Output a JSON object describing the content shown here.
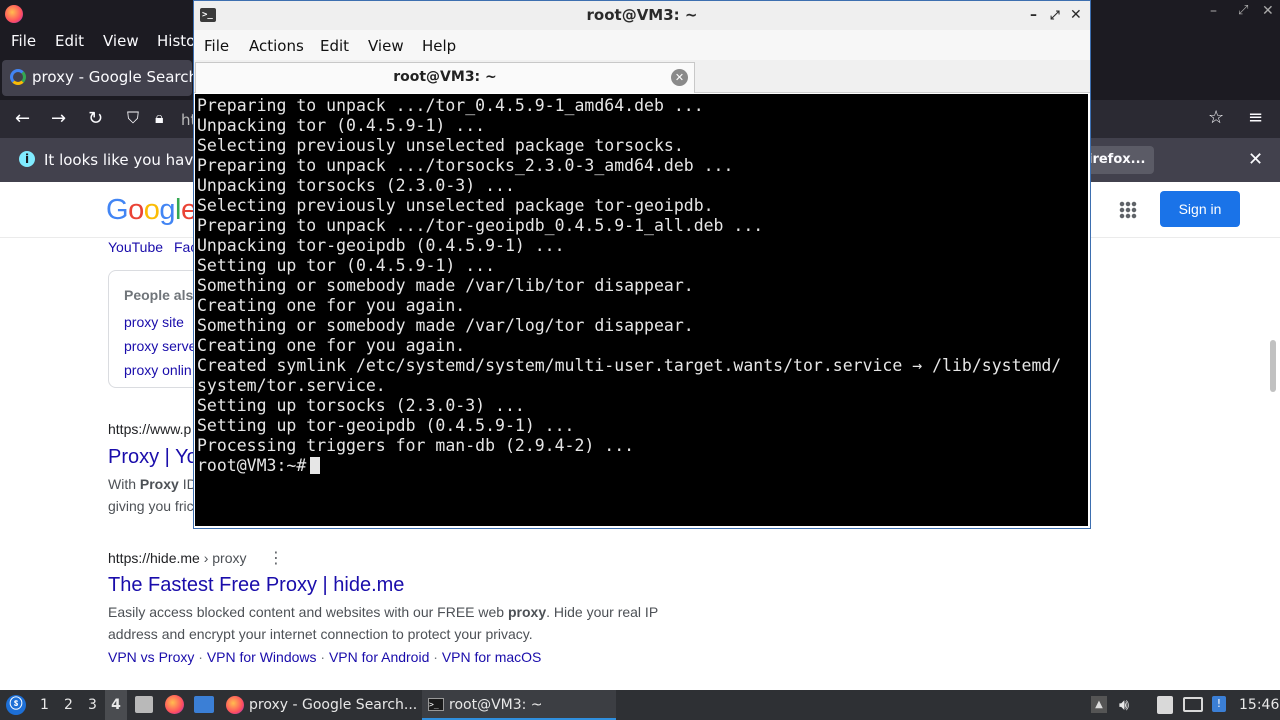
{
  "firefox": {
    "menu": [
      "File",
      "Edit",
      "View",
      "Histo"
    ],
    "tab_title": "proxy - Google Search",
    "url_partial": "ht",
    "notification_text": "It looks like you haven",
    "notification_button_partial": "irefox..."
  },
  "google": {
    "logo_partial": "Google",
    "signin_label": "Sign in",
    "chips": [
      "YouTube",
      "Fac"
    ],
    "people_also_title": "People als",
    "people_also_items": [
      "proxy site",
      "proxy serve",
      "proxy onlin"
    ],
    "result1": {
      "url": "https://www.p",
      "title": "Proxy | Yo",
      "snippet_line1_pre": "With ",
      "snippet_line1_bold": "Proxy",
      "snippet_line1_post": " ID",
      "snippet_line2": "giving you fric"
    },
    "result2": {
      "url_domain": "https://hide.me",
      "url_path": " › proxy",
      "title": "The Fastest Free Proxy | hide.me",
      "snippet_line1_pre": "Easily access blocked content and websites with our FREE web ",
      "snippet_line1_bold": "proxy",
      "snippet_line1_post": ". Hide your real IP",
      "snippet_line2": "address and encrypt your internet connection to protect your privacy.",
      "sitelinks": [
        "VPN vs Proxy",
        "VPN for Windows",
        "VPN for Android",
        "VPN for macOS"
      ]
    }
  },
  "terminal": {
    "window_title": "root@VM3: ~",
    "menu": [
      "File",
      "Actions",
      "Edit",
      "View",
      "Help"
    ],
    "tab_title": "root@VM3: ~",
    "lines": [
      "Preparing to unpack .../tor_0.4.5.9-1_amd64.deb ...",
      "Unpacking tor (0.4.5.9-1) ...",
      "Selecting previously unselected package torsocks.",
      "Preparing to unpack .../torsocks_2.3.0-3_amd64.deb ...",
      "Unpacking torsocks (2.3.0-3) ...",
      "Selecting previously unselected package tor-geoipdb.",
      "Preparing to unpack .../tor-geoipdb_0.4.5.9-1_all.deb ...",
      "Unpacking tor-geoipdb (0.4.5.9-1) ...",
      "Setting up tor (0.4.5.9-1) ...",
      "Something or somebody made /var/lib/tor disappear.",
      "Creating one for you again.",
      "Something or somebody made /var/log/tor disappear.",
      "Creating one for you again.",
      "Created symlink /etc/systemd/system/multi-user.target.wants/tor.service → /lib/systemd/",
      "system/tor.service.",
      "Setting up torsocks (2.3.0-3) ...",
      "Setting up tor-geoipdb (0.4.5.9-1) ...",
      "Processing triggers for man-db (2.9.4-2) ..."
    ],
    "prompt": "root@VM3:~#"
  },
  "taskbar": {
    "workspaces": [
      "1",
      "2",
      "3",
      "4"
    ],
    "active_workspace": "4",
    "firefox_task": "proxy - Google Search...",
    "terminal_task": "root@VM3: ~",
    "clock": "15:46"
  },
  "colors": {
    "firefox_dark": "#1c1b22",
    "google_blue": "#1a73e8",
    "link": "#1a0dab",
    "terminal_bg": "#000000",
    "terminal_fg": "#e6e6e6",
    "taskbar": "#2e3034"
  }
}
